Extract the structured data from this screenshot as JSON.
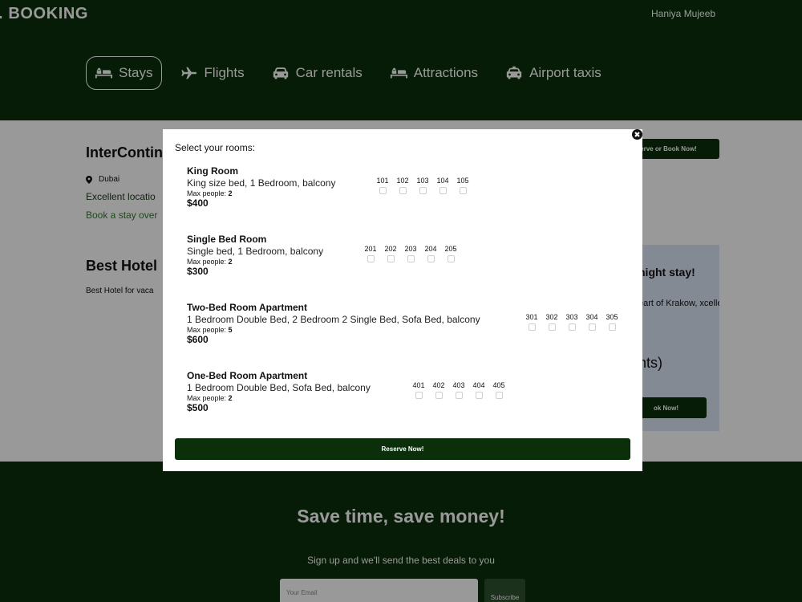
{
  "header": {
    "logo": ". BOOKING",
    "user_name": "Haniya Mujeeb",
    "nav": [
      {
        "label": "Stays",
        "icon": "bed-icon",
        "active": true
      },
      {
        "label": "Flights",
        "icon": "plane-icon",
        "active": false
      },
      {
        "label": "Car rentals",
        "icon": "car-icon",
        "active": false
      },
      {
        "label": "Attractions",
        "icon": "bed-icon",
        "active": false
      },
      {
        "label": "Airport taxis",
        "icon": "taxi-icon",
        "active": false
      }
    ]
  },
  "main": {
    "hotel1": {
      "title": "InterContin",
      "location": "Dubai",
      "line1": "Excellent locatio",
      "line2": "Book a stay over",
      "button": "erve or Book Now!"
    },
    "hotel2": {
      "title": "Best Hotel",
      "desc": "Best Hotel for vaca"
    },
    "promo": {
      "title": "night stay!",
      "desc": "eart of Krakow, xcellent",
      "nights": "hts)",
      "button": "ok Now!"
    }
  },
  "modal": {
    "heading": "Select your rooms:",
    "max_people_label": "Max people:",
    "rooms": [
      {
        "name": "King Room",
        "desc": "King size bed, 1 Bedroom, balcony",
        "max_people": "2",
        "price": "$400",
        "numbers": [
          "101",
          "102",
          "103",
          "104",
          "105"
        ]
      },
      {
        "name": "Single Bed Room",
        "desc": "Single bed, 1 Bedroom, balcony",
        "max_people": "2",
        "price": "$300",
        "numbers": [
          "201",
          "202",
          "203",
          "204",
          "205"
        ]
      },
      {
        "name": "Two-Bed Room Apartment",
        "desc": "1 Bedroom Double Bed, 2 Bedroom 2 Single Bed, Sofa Bed, balcony",
        "max_people": "5",
        "price": "$600",
        "numbers": [
          "301",
          "302",
          "303",
          "304",
          "305"
        ]
      },
      {
        "name": "One-Bed Room Apartment",
        "desc": "1 Bedroom Double Bed, Sofa Bed, balcony",
        "max_people": "2",
        "price": "$500",
        "numbers": [
          "401",
          "402",
          "403",
          "404",
          "405"
        ]
      }
    ],
    "reserve_button": "Reserve Now!"
  },
  "footer": {
    "title": "Save time, save money!",
    "subtitle": "Sign up and we'll send the best deals to you",
    "email_placeholder": "Your Email",
    "subscribe": "Subscribe"
  },
  "colors": {
    "brand_dark_green": "#0b2f0b",
    "overlay": "rgba(0,0,0,0.4)",
    "promo_bg": "#dde7f5"
  }
}
